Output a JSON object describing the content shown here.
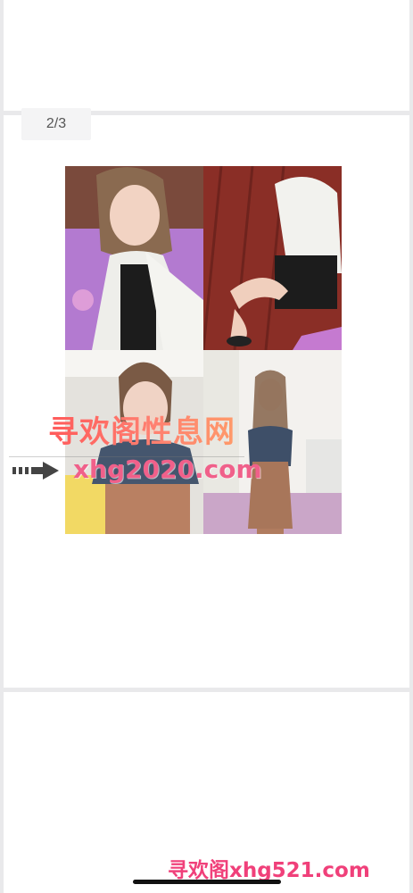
{
  "gallery": {
    "page_counter": "2/3"
  },
  "watermark": {
    "chinese_text": "寻欢阁性息网",
    "url_text": "xhg2020.com",
    "arrow_icon": "arrow-right-icon"
  },
  "footer_watermark": {
    "text": "寻欢阁xhg521.com"
  },
  "colors": {
    "page_bg": "#e9e9eb",
    "card_bg": "#ffffff",
    "watermark_pink": "#f0608a",
    "footer_watermark_pink": "#f0407a"
  }
}
